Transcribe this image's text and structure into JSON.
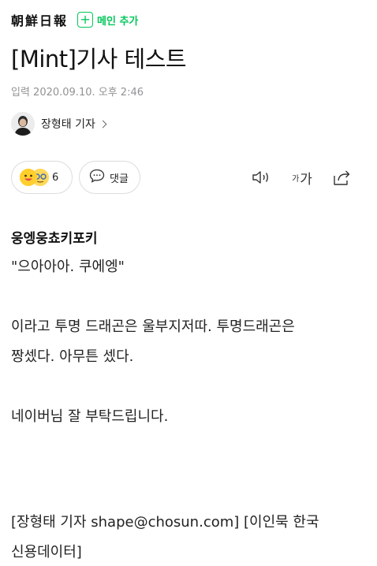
{
  "header": {
    "press_logo": "朝鮮日報",
    "add_main_label": "메인 추가"
  },
  "article": {
    "title": "[Mint]기사 테스트",
    "date": "입력 2020.09.10. 오후 2:46",
    "author": "장형태 기자"
  },
  "actions": {
    "reaction_count": "6",
    "comment_label": "댓글",
    "font_small": "가",
    "font_big": "가"
  },
  "body": {
    "subhead": "웅엥웅쵸키포키",
    "quote": "\"으아아아. 쿠에엥\"",
    "para1_line1": "이라고 투명 드래곤은 울부지저따. 투명드래곤은",
    "para1_line2": "짱셌다. 아무튼 셌다.",
    "para2": "네이버님 잘 부탁드립니다.",
    "byline_line1": "[장형태 기자 shape@chosun.com] [이인묵 한국",
    "byline_line2": "신용데이터]"
  },
  "colors": {
    "accent_green": "#03c75a",
    "meta_gray": "#929294"
  },
  "icons": [
    "plus-icon",
    "avatar",
    "chevron-right-icon",
    "emoji-smile-icon",
    "emoji-glasses-icon",
    "comment-icon",
    "speaker-icon",
    "font-size-icon",
    "share-icon"
  ]
}
